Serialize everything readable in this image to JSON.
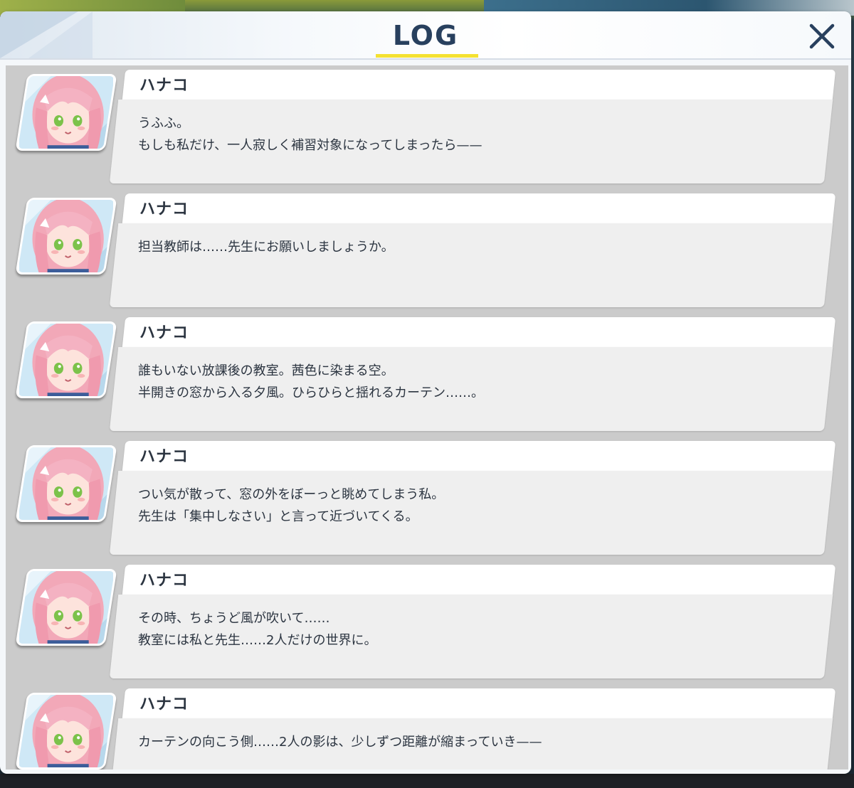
{
  "dialog": {
    "title": "LOG",
    "close_icon": "close-icon"
  },
  "entries": [
    {
      "speaker": "ハナコ",
      "lines": [
        "うふふ。",
        "もしも私だけ、一人寂しく補習対象になってしまったら——"
      ]
    },
    {
      "speaker": "ハナコ",
      "lines": [
        "担当教師は……先生にお願いしましょうか。",
        ""
      ]
    },
    {
      "speaker": "ハナコ",
      "lines": [
        "誰もいない放課後の教室。茜色に染まる空。",
        "半開きの窓から入る夕風。ひらひらと揺れるカーテン……。"
      ]
    },
    {
      "speaker": "ハナコ",
      "lines": [
        "つい気が散って、窓の外をぼーっと眺めてしまう私。",
        "先生は「集中しなさい」と言って近づいてくる。"
      ]
    },
    {
      "speaker": "ハナコ",
      "lines": [
        "その時、ちょうど風が吹いて……",
        "教室には私と先生……2人だけの世界に。"
      ]
    },
    {
      "speaker": "ハナコ",
      "lines": [
        "カーテンの向こう側……2人の影は、少しずつ距離が縮まっていき——",
        ""
      ]
    }
  ],
  "colors": {
    "title": "#28405e",
    "underline_accent": "#f4e132",
    "text": "#2b3440"
  }
}
